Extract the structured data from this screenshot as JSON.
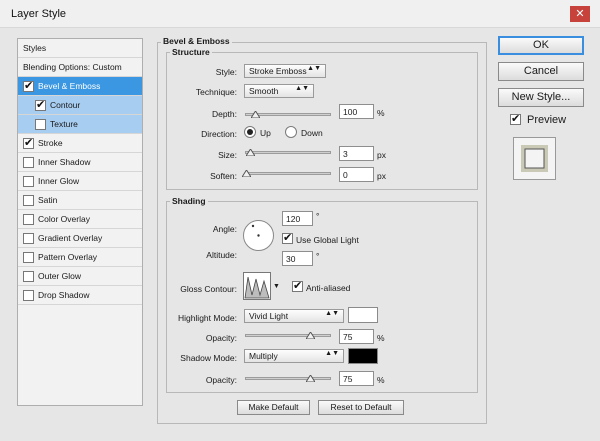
{
  "window": {
    "title": "Layer Style",
    "close_glyph": "✕"
  },
  "styles_list": {
    "header": "Styles",
    "blending": "Blending Options: Custom",
    "items": [
      {
        "label": "Bevel & Emboss",
        "checked": true
      },
      {
        "label": "Contour",
        "checked": true
      },
      {
        "label": "Texture",
        "checked": false
      },
      {
        "label": "Stroke",
        "checked": true
      },
      {
        "label": "Inner Shadow",
        "checked": false
      },
      {
        "label": "Inner Glow",
        "checked": false
      },
      {
        "label": "Satin",
        "checked": false
      },
      {
        "label": "Color Overlay",
        "checked": false
      },
      {
        "label": "Gradient Overlay",
        "checked": false
      },
      {
        "label": "Pattern Overlay",
        "checked": false
      },
      {
        "label": "Outer Glow",
        "checked": false
      },
      {
        "label": "Drop Shadow",
        "checked": false
      }
    ]
  },
  "bevel": {
    "section_title": "Bevel & Emboss",
    "structure": {
      "title": "Structure",
      "style_label": "Style:",
      "style_value": "Stroke Emboss",
      "technique_label": "Technique:",
      "technique_value": "Smooth",
      "depth_label": "Depth:",
      "depth_value": "100",
      "depth_unit": "%",
      "depth_pct": 0.1,
      "direction_label": "Direction:",
      "dir_up": "Up",
      "dir_down": "Down",
      "size_label": "Size:",
      "size_value": "3",
      "size_unit": "px",
      "soften_label": "Soften:",
      "soften_value": "0",
      "soften_unit": "px"
    },
    "shading": {
      "title": "Shading",
      "angle_label": "Angle:",
      "angle_value": "120",
      "angle_unit": "°",
      "use_global_light": "Use Global Light",
      "use_global_light_checked": true,
      "altitude_label": "Altitude:",
      "altitude_value": "30",
      "altitude_unit": "°",
      "gloss_label": "Gloss Contour:",
      "anti_aliased": "Anti-aliased",
      "anti_aliased_checked": true,
      "highlight_label": "Highlight Mode:",
      "highlight_value": "Vivid Light",
      "highlight_color": "#ffffff",
      "opacity_label": "Opacity:",
      "opacity1_value": "75",
      "opacity_unit": "%",
      "shadow_label": "Shadow Mode:",
      "shadow_value": "Multiply",
      "shadow_color": "#000000",
      "opacity2_value": "75"
    },
    "make_default": "Make Default",
    "reset_default": "Reset to Default"
  },
  "actions": {
    "ok": "OK",
    "cancel": "Cancel",
    "new_style": "New Style...",
    "preview": "Preview",
    "preview_checked": true
  }
}
